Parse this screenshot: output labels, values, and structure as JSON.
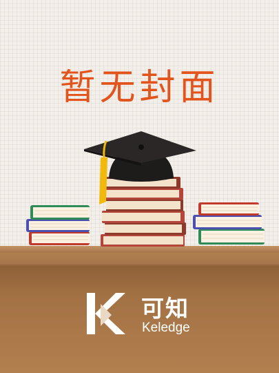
{
  "cover": {
    "placeholder_title": "暂无封面",
    "brand_name_cn": "可知",
    "brand_name_en": "Keledge"
  },
  "colors": {
    "title_color": "#e2541c",
    "background": "#f3f0eb",
    "shelf": "#a5744a",
    "brand_text": "#ffffff",
    "tassel": "#f2b90d"
  },
  "icons": {
    "logo": "keledge-k-logo-icon",
    "cap": "graduation-cap-icon",
    "books": "book-stack-icon"
  }
}
